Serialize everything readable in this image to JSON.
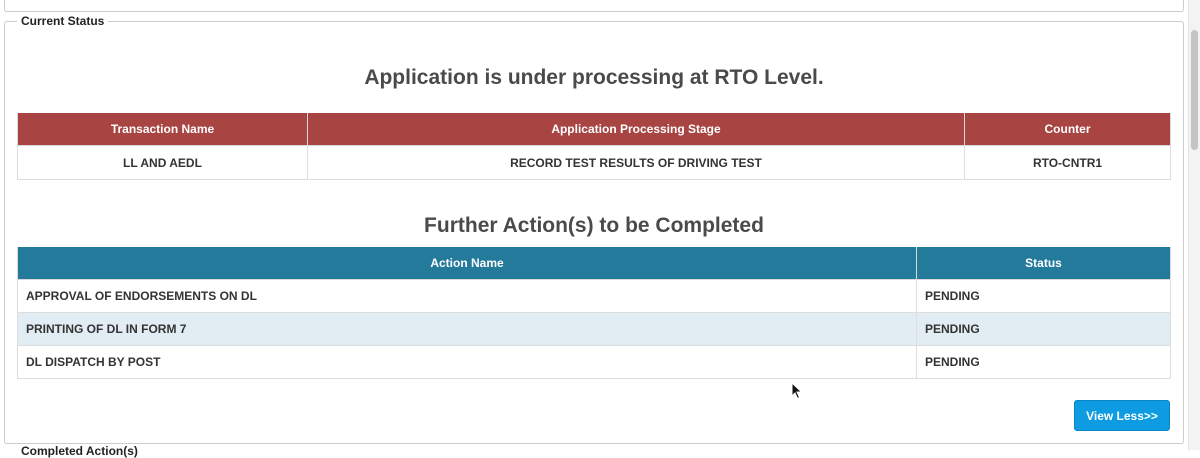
{
  "current_status": {
    "legend": "Current Status",
    "heading": "Application is under processing at RTO Level.",
    "processing_table": {
      "headers": [
        "Transaction Name",
        "Application Processing Stage",
        "Counter"
      ],
      "row": [
        "LL AND AEDL",
        "RECORD TEST RESULTS OF DRIVING TEST",
        "RTO-CNTR1"
      ]
    },
    "further_heading": "Further Action(s) to be Completed",
    "actions_table": {
      "headers": [
        "Action Name",
        "Status"
      ],
      "rows": [
        [
          "APPROVAL OF ENDORSEMENTS ON DL",
          "PENDING"
        ],
        [
          "PRINTING OF DL IN FORM 7",
          "PENDING"
        ],
        [
          "DL DISPATCH BY POST",
          "PENDING"
        ]
      ]
    },
    "view_less_label": "View Less>>"
  },
  "next_section": {
    "legend": "Completed Action(s)"
  },
  "colors": {
    "processing_header": "#a84442",
    "actions_header": "#237a9b",
    "alt_row": "#e2ecf3",
    "button": "#0d9be1"
  }
}
